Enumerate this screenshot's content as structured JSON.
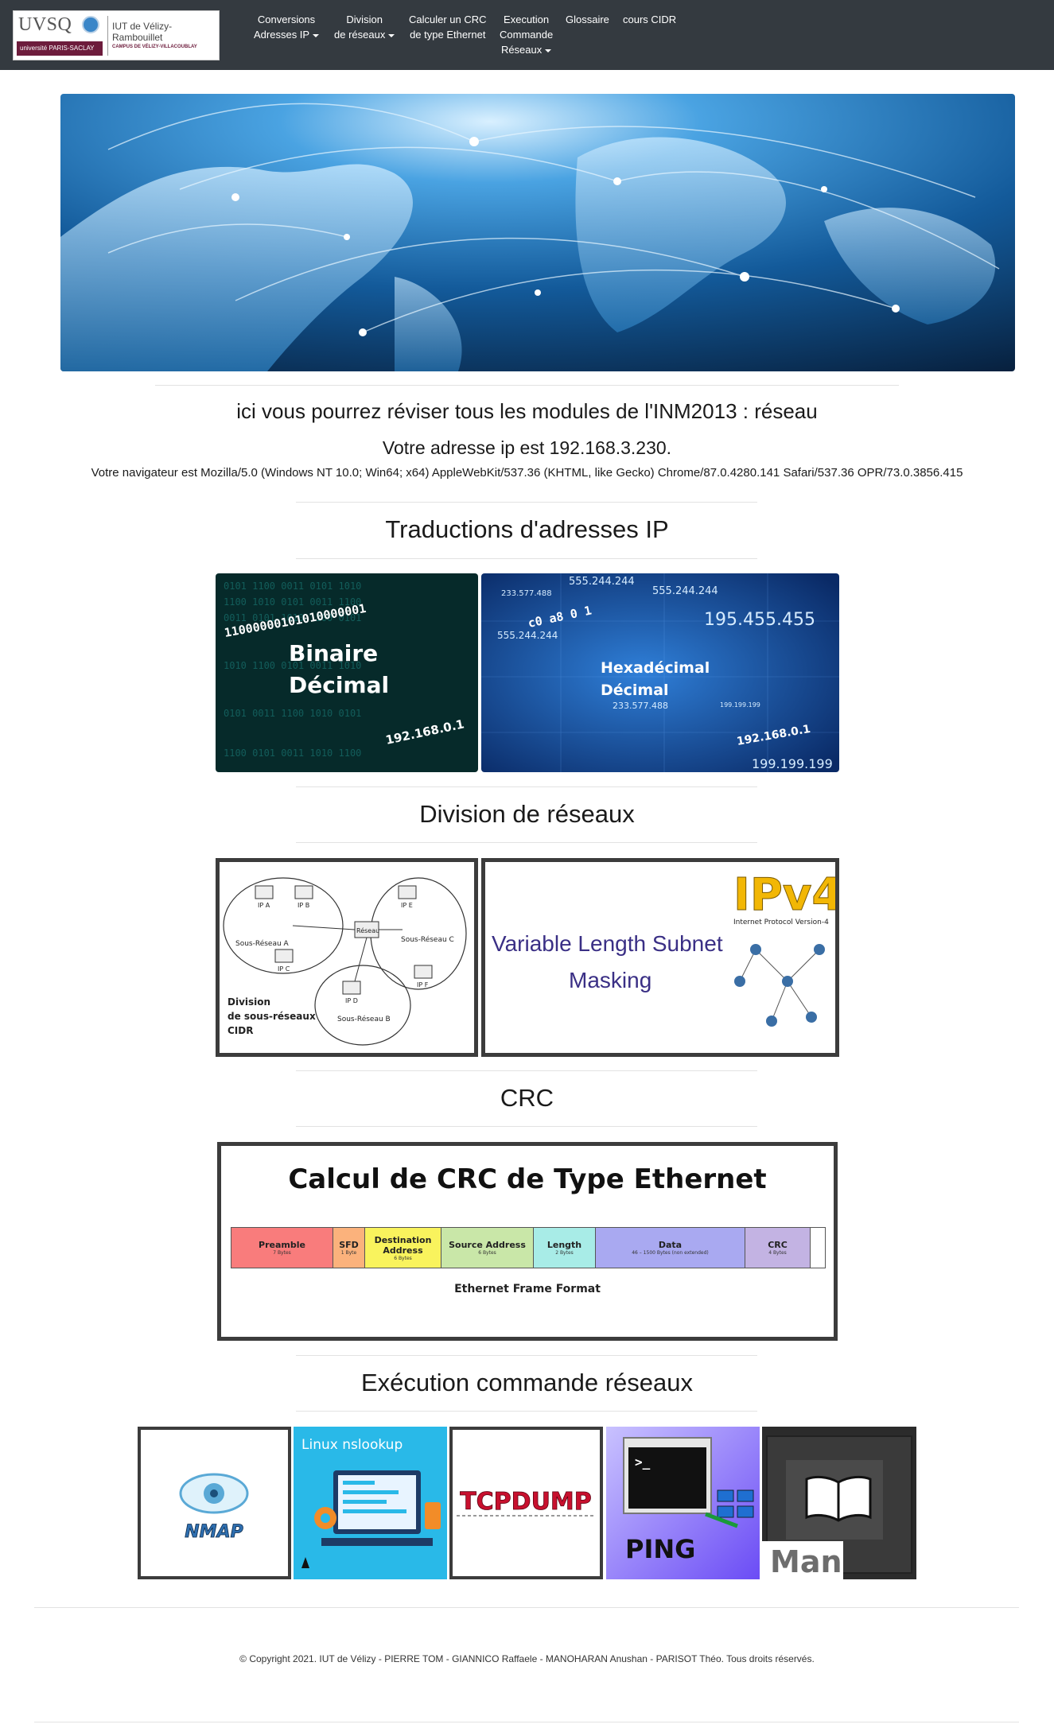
{
  "logo": {
    "uvsq": "UVSQ",
    "iut": "IUT de Vélizy-Rambouillet",
    "universite": "université PARIS-SACLAY",
    "campus": "CAMPUS DE VÉLIZY-VILLACOUBLAY"
  },
  "nav": {
    "conversions": [
      "Conversions",
      "Adresses IP"
    ],
    "division": [
      "Division",
      "de réseaux"
    ],
    "crc": [
      "Calculer un CRC",
      "de type Ethernet"
    ],
    "execution": [
      "Execution",
      "Commande",
      "Réseaux"
    ],
    "glossaire": "Glossaire",
    "cidr": "cours CIDR"
  },
  "intro": {
    "tagline": "ici vous pourrez réviser tous les modules de l'INM2013 : réseau",
    "ip": "Votre adresse ip est 192.168.3.230.",
    "ua": "Votre navigateur est Mozilla/5.0 (Windows NT 10.0; Win64; x64) AppleWebKit/537.36 (KHTML, like Gecko) Chrome/87.0.4280.141 Safari/537.36 OPR/73.0.3856.415"
  },
  "sections": {
    "traductions": "Traductions d'adresses IP",
    "division": "Division de réseaux",
    "crc": "CRC",
    "execution": "Exécution commande réseaux"
  },
  "cards": {
    "binaire": {
      "bits": "11000000101010000001",
      "line1": "Binaire",
      "line2": "Décimal",
      "ip": "192.168.0.1"
    },
    "hexa": {
      "n1": "555.244.244",
      "n2": "233.577.488",
      "n3": "555.244.244",
      "n4": "195.455.455",
      "hex": "c0 a8 0 1",
      "n5": "555.244.244",
      "line1": "Hexadécimal",
      "line2": "Décimal",
      "n6": "233.577.488",
      "ip": "192.168.0.1",
      "n7": "199.199.199",
      "n8": "199.199.199"
    },
    "cidr": {
      "ipa": "IP A",
      "ipb": "IP B",
      "ipc": "IP C",
      "ipd": "IP D",
      "ipe": "IP E",
      "ipf": "IP F",
      "sra": "Sous-Réseau A",
      "srb": "Sous-Réseau B",
      "src": "Sous-Réseau C",
      "reseau": "Réseau",
      "caption1": "Division",
      "caption2": "de sous-réseaux",
      "caption3": "CIDR"
    },
    "vlsm": {
      "line1": "Variable Length Subnet",
      "line2": "Masking",
      "ipv4": "IPv4",
      "sub": "Internet Protocol Version-4"
    },
    "crc": {
      "title": "Calcul de CRC de Type Ethernet",
      "fields": [
        {
          "name": "Preamble",
          "size": "7 Bytes",
          "color": "#f97c7c"
        },
        {
          "name": "SFD",
          "size": "1 Byte",
          "color": "#fbb27c"
        },
        {
          "name": "Destination Address",
          "size": "6 Bytes",
          "color": "#f9f35d"
        },
        {
          "name": "Source Address",
          "size": "6 Bytes",
          "color": "#c9e7a8"
        },
        {
          "name": "Length",
          "size": "2 Bytes",
          "color": "#a8ece7"
        },
        {
          "name": "Data",
          "size": "46 – 1500 Bytes (non extended)",
          "color": "#a9a9f1"
        },
        {
          "name": "CRC",
          "size": "4 Bytes",
          "color": "#c3b3e3"
        }
      ],
      "caption": "Ethernet Frame Format"
    },
    "nmap": "NMAP",
    "nslookup": "Linux nslookup",
    "tcpdump": "TCPDUMP",
    "ping": "PING",
    "man": "Man"
  },
  "footer": "© Copyright 2021. IUT de Vélizy - PIERRE TOM - GIANNICO Raffaele - MANOHARAN Anushan - PARISOT Théo. Tous droits réservés."
}
